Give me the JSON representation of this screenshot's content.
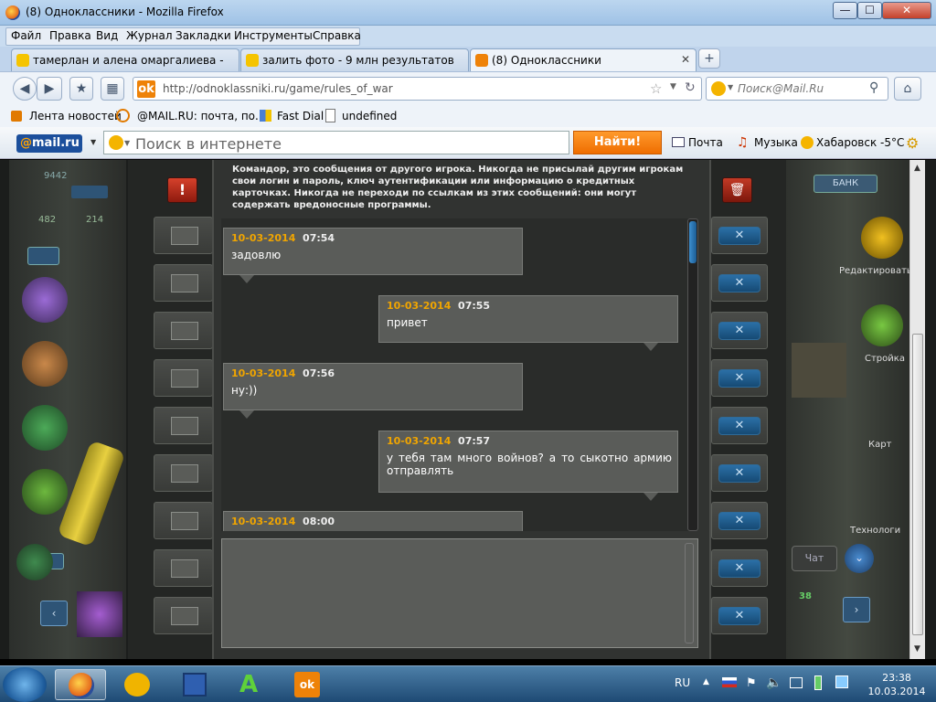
{
  "window": {
    "title": "(8) Одноклассники - Mozilla Firefox",
    "min": "—",
    "max": "☐",
    "close": "✕"
  },
  "menu": [
    "Файл",
    "Правка",
    "Вид",
    "Журнал",
    "Закладки",
    "Инструменты",
    "Справка"
  ],
  "tabs": [
    {
      "label": "тамерлан и алена омаргалиева - 1 ...",
      "active": false
    },
    {
      "label": "залить фото - 9 млн результатов. П...",
      "active": false
    },
    {
      "label": "(8) Одноклассники",
      "active": true
    }
  ],
  "new_tab": "+",
  "nav": {
    "url_host": "http://odnoklassniki.ru",
    "url_path": "/game/rules_of_war",
    "search_placeholder": "Поиск@Mail.Ru"
  },
  "bookmarks": [
    "Лента новостей",
    "@MAIL.RU: почта, по...",
    "Fast Dial",
    "undefined"
  ],
  "mailru": {
    "logo_at": "@",
    "logo_text": "mail.ru",
    "search_placeholder": "Поиск в интернете",
    "find_button": "Найти!",
    "mail_link": "Почта",
    "music_link": "Музыка",
    "weather": "Хабаровск -5°C"
  },
  "game": {
    "warning": "Командор, это сообщения от другого игрока. Никогда не присылай другим игрокам свои логин и пароль, ключ аутентификации или информацию о кредитных карточках. Никогда не переходи по ссылкам из этих сообщений: они могут содержать вредоносные программы.",
    "left_numbers": [
      "9442",
      "482",
      "214"
    ],
    "right_labels": {
      "bank": "БАНК",
      "edit": "Редактировать",
      "build": "Стройка",
      "map": "Карт",
      "tech": "Технологи",
      "chat": "Чат",
      "count": "38"
    },
    "delete_x": "✕",
    "messages": [
      {
        "date": "10-03-2014",
        "time": "07:54",
        "text": "задовлю",
        "side": "left"
      },
      {
        "date": "10-03-2014",
        "time": "07:55",
        "text": "привет",
        "side": "right"
      },
      {
        "date": "10-03-2014",
        "time": "07:56",
        "text": "ну:))",
        "side": "left"
      },
      {
        "date": "10-03-2014",
        "time": "07:57",
        "text": "у тебя там много войнов? а то сыкотно армию отправлять",
        "side": "right"
      },
      {
        "date": "10-03-2014",
        "time": "08:00",
        "text": "",
        "side": "left"
      }
    ]
  },
  "taskbar": {
    "lang": "RU",
    "time": "23:38",
    "date": "10.03.2014"
  }
}
